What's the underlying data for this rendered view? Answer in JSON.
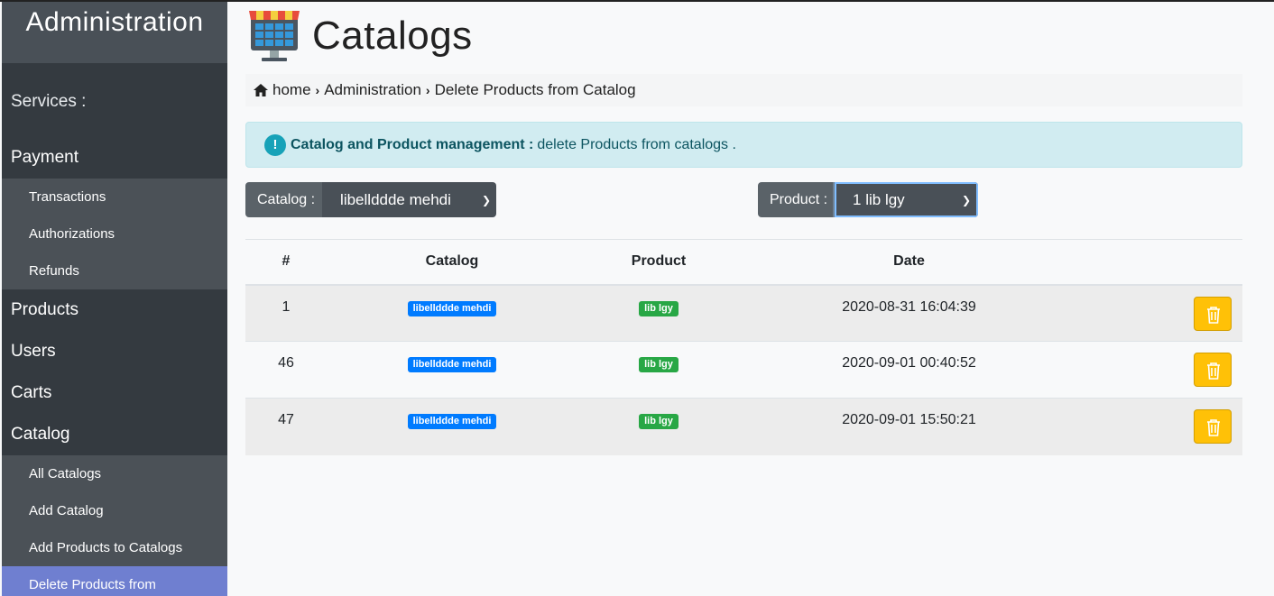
{
  "sidebar": {
    "brand": "Administration",
    "section": "Services :",
    "payment": {
      "label": "Payment",
      "items": [
        "Transactions",
        "Authorizations",
        "Refunds"
      ]
    },
    "products": "Products",
    "users": "Users",
    "carts": "Carts",
    "catalog": {
      "label": "Catalog",
      "items": [
        "All Catalogs",
        "Add Catalog",
        "Add Products to Catalogs",
        "Delete Products from"
      ]
    }
  },
  "header": {
    "title": "Catalogs"
  },
  "breadcrumb": {
    "home": "home",
    "admin": "Administration",
    "current": "Delete Products from Catalog"
  },
  "alert": {
    "strong": "Catalog and Product management :",
    "text": "delete Products from catalogs ."
  },
  "filters": {
    "catalog_label": "Catalog :",
    "catalog_value": "libellddde mehdi",
    "product_label": "Product :",
    "product_value": "1 lib lgy"
  },
  "table": {
    "headers": [
      "#",
      "Catalog",
      "Product",
      "Date"
    ],
    "rows": [
      {
        "id": "1",
        "catalog": "libellddde mehdi",
        "product": "lib lgy",
        "date": "2020-08-31 16:04:39"
      },
      {
        "id": "46",
        "catalog": "libellddde mehdi",
        "product": "lib lgy",
        "date": "2020-09-01 00:40:52"
      },
      {
        "id": "47",
        "catalog": "libellddde mehdi",
        "product": "lib lgy",
        "date": "2020-09-01 15:50:21"
      }
    ]
  },
  "colors": {
    "sidebar": "#343a40",
    "active": "#6f7fd0",
    "alert_bg": "#d1ecf1",
    "warning": "#ffc107",
    "badge_blue": "#007bff",
    "badge_green": "#28a745"
  }
}
